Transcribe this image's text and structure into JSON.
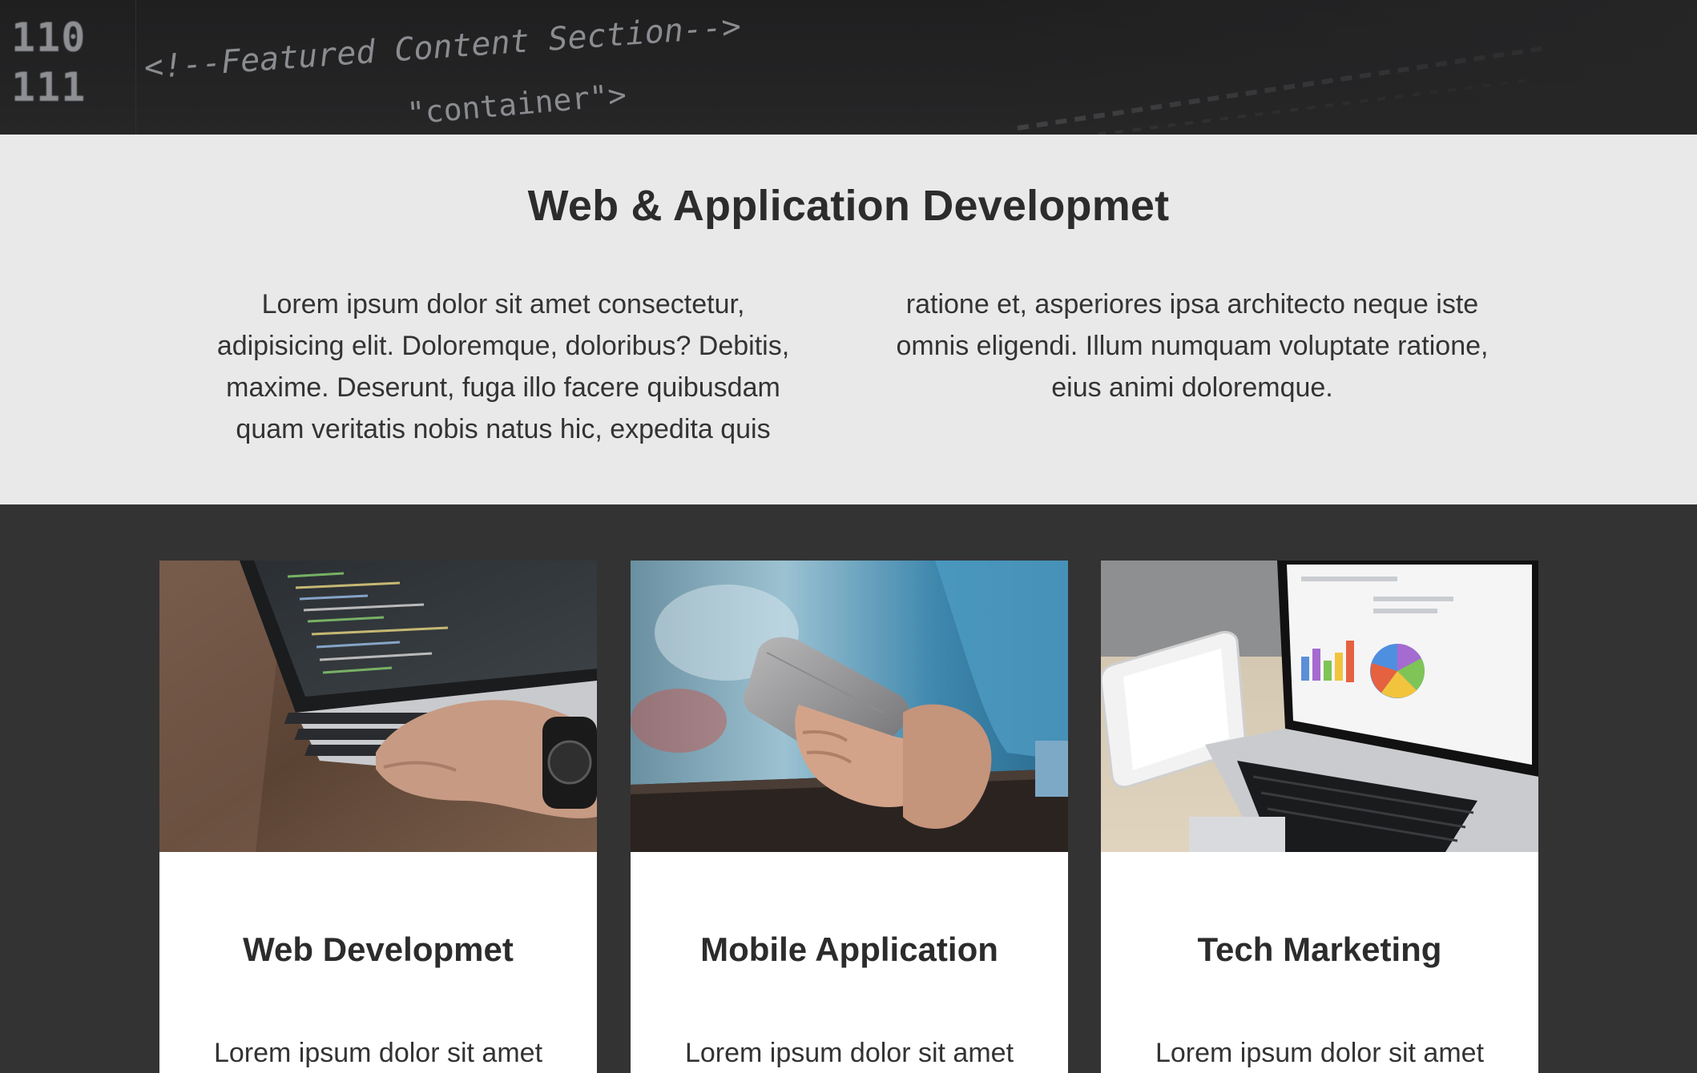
{
  "code_banner": {
    "line_numbers": [
      "110",
      "111"
    ],
    "code_lines": [
      "<!--Featured Content Section-->",
      "\"container\">"
    ]
  },
  "intro": {
    "title": "Web & Application Developmet",
    "left_text": "Lorem ipsum dolor sit amet consectetur, adipisicing elit. Doloremque, doloribus? Debitis, maxime. Deserunt, fuga illo facere quibusdam quam veritatis nobis natus hic, expedita quis",
    "right_text": "ratione et, asperiores ipsa architecto neque iste omnis eligendi. Illum numquam voluptate ratione, eius animi doloremque."
  },
  "cards": [
    {
      "title": "Web Developmet",
      "text": "Lorem ipsum dolor sit amet",
      "image": "laptop-coding-photo"
    },
    {
      "title": "Mobile Application",
      "text": "Lorem ipsum dolor sit amet",
      "image": "smartphone-in-hands-photo"
    },
    {
      "title": "Tech Marketing",
      "text": "Lorem ipsum dolor sit amet",
      "image": "laptop-tablet-charts-photo"
    }
  ],
  "colors": {
    "page_dark": "#333333",
    "intro_bg": "#e9e9e9",
    "card_bg": "#ffffff",
    "heading_text": "#2c2c2c"
  }
}
